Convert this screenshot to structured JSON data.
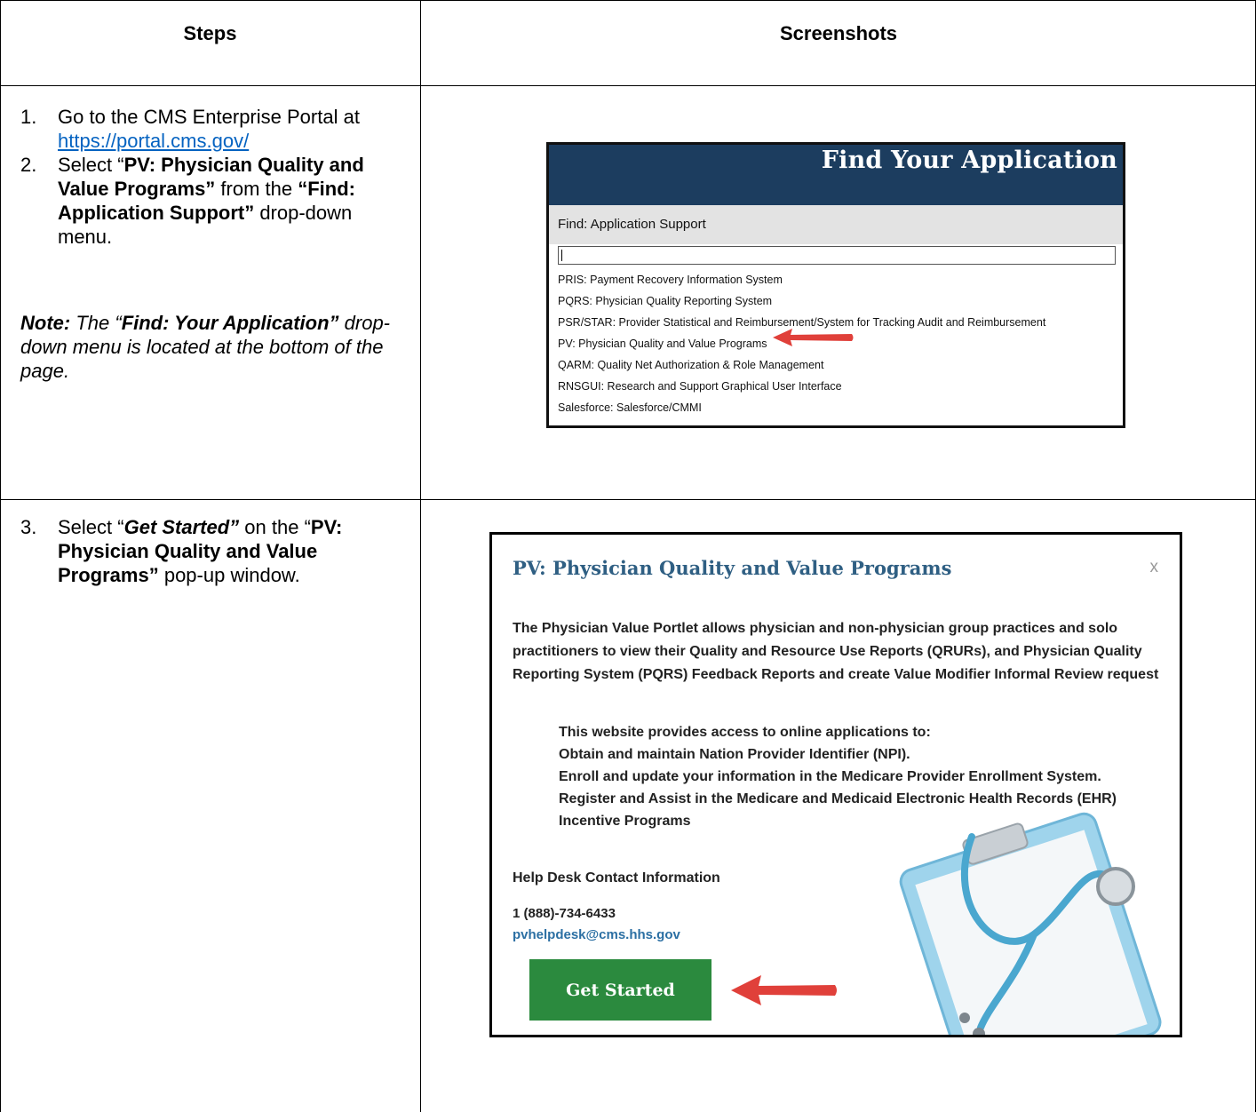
{
  "table": {
    "header_steps": "Steps",
    "header_screenshots": "Screenshots"
  },
  "step1": {
    "num": "1.",
    "text": "Go to the CMS Enterprise Portal at",
    "link": "https://portal.cms.gov/"
  },
  "step2": {
    "num": "2.",
    "select": "Select “",
    "bold1": "PV: Physician Quality and Value Programs”",
    "from": " from the ",
    "bold2": "“Find: Application Support”",
    "rest": " drop-down menu."
  },
  "note": {
    "label": "Note:",
    "t1": "  The “",
    "bold": "Find: Your Application”",
    "t2": " drop-down menu is located at the bottom of the page."
  },
  "step3": {
    "num": "3.",
    "select": "Select “",
    "bold_italic": "Get Started”",
    "on": " on the “",
    "bold": "PV: Physician Quality and Value Programs”",
    "rest": " pop-up window."
  },
  "shot1": {
    "title": "Find Your Application",
    "find_label": "Find: Application Support",
    "items": [
      "PRIS: Payment Recovery Information System",
      "PQRS: Physician Quality Reporting System",
      "PSR/STAR: Provider Statistical and Reimbursement/System for Tracking Audit and Reimbursement",
      "PV: Physician Quality and Value Programs",
      "QARM: Quality Net Authorization & Role Management",
      "RNSGUI: Research and Support Graphical User Interface",
      "Salesforce: Salesforce/CMMI"
    ]
  },
  "shot2": {
    "title": "PV: Physician Quality and Value Programs",
    "close": "x",
    "description": "The Physician Value Portlet allows physician and non-physician group practices and solo practitioners to view their Quality and Resource Use Reports (QRURs), and Physician Quality Reporting System (PQRS) Feedback Reports and create Value Modifier Informal Review request",
    "list": [
      "This website provides access to online applications to:",
      "Obtain and maintain Nation Provider Identifier (NPI).",
      "Enroll and update your information in the Medicare Provider Enrollment System.",
      "Register and Assist in the Medicare and Medicaid Electronic Health Records (EHR) Incentive Programs"
    ],
    "help_heading": "Help Desk Contact Information",
    "phone": "1 (888)-734-6433",
    "email": "pvhelpdesk@cms.hhs.gov",
    "button": "Get Started"
  },
  "colors": {
    "portal_header_bg": "#1c3d5f",
    "pv_title": "#2f5f83",
    "button_bg": "#2b8a3e",
    "arrow": "#e0403a",
    "link": "#0563c1"
  }
}
